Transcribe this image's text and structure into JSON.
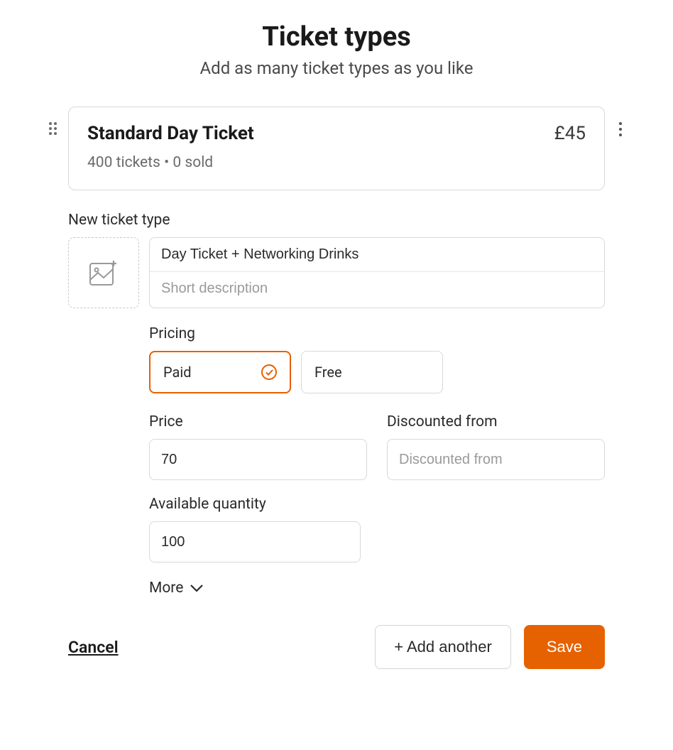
{
  "header": {
    "title": "Ticket types",
    "subtitle": "Add as many ticket types as you like"
  },
  "existing_ticket": {
    "name": "Standard Day Ticket",
    "price_display": "£45",
    "stats": "400 tickets • 0 sold"
  },
  "new_ticket": {
    "section_label": "New ticket type",
    "name_value": "Day Ticket + Networking Drinks",
    "description_placeholder": "Short description",
    "pricing_label": "Pricing",
    "option_paid": "Paid",
    "option_free": "Free",
    "price_label": "Price",
    "price_value": "70",
    "discounted_label": "Discounted from",
    "discounted_placeholder": "Discounted from",
    "quantity_label": "Available quantity",
    "quantity_value": "100",
    "more_label": "More"
  },
  "footer": {
    "cancel": "Cancel",
    "add_another": "+ Add another",
    "save": "Save"
  },
  "colors": {
    "accent": "#e66100"
  }
}
